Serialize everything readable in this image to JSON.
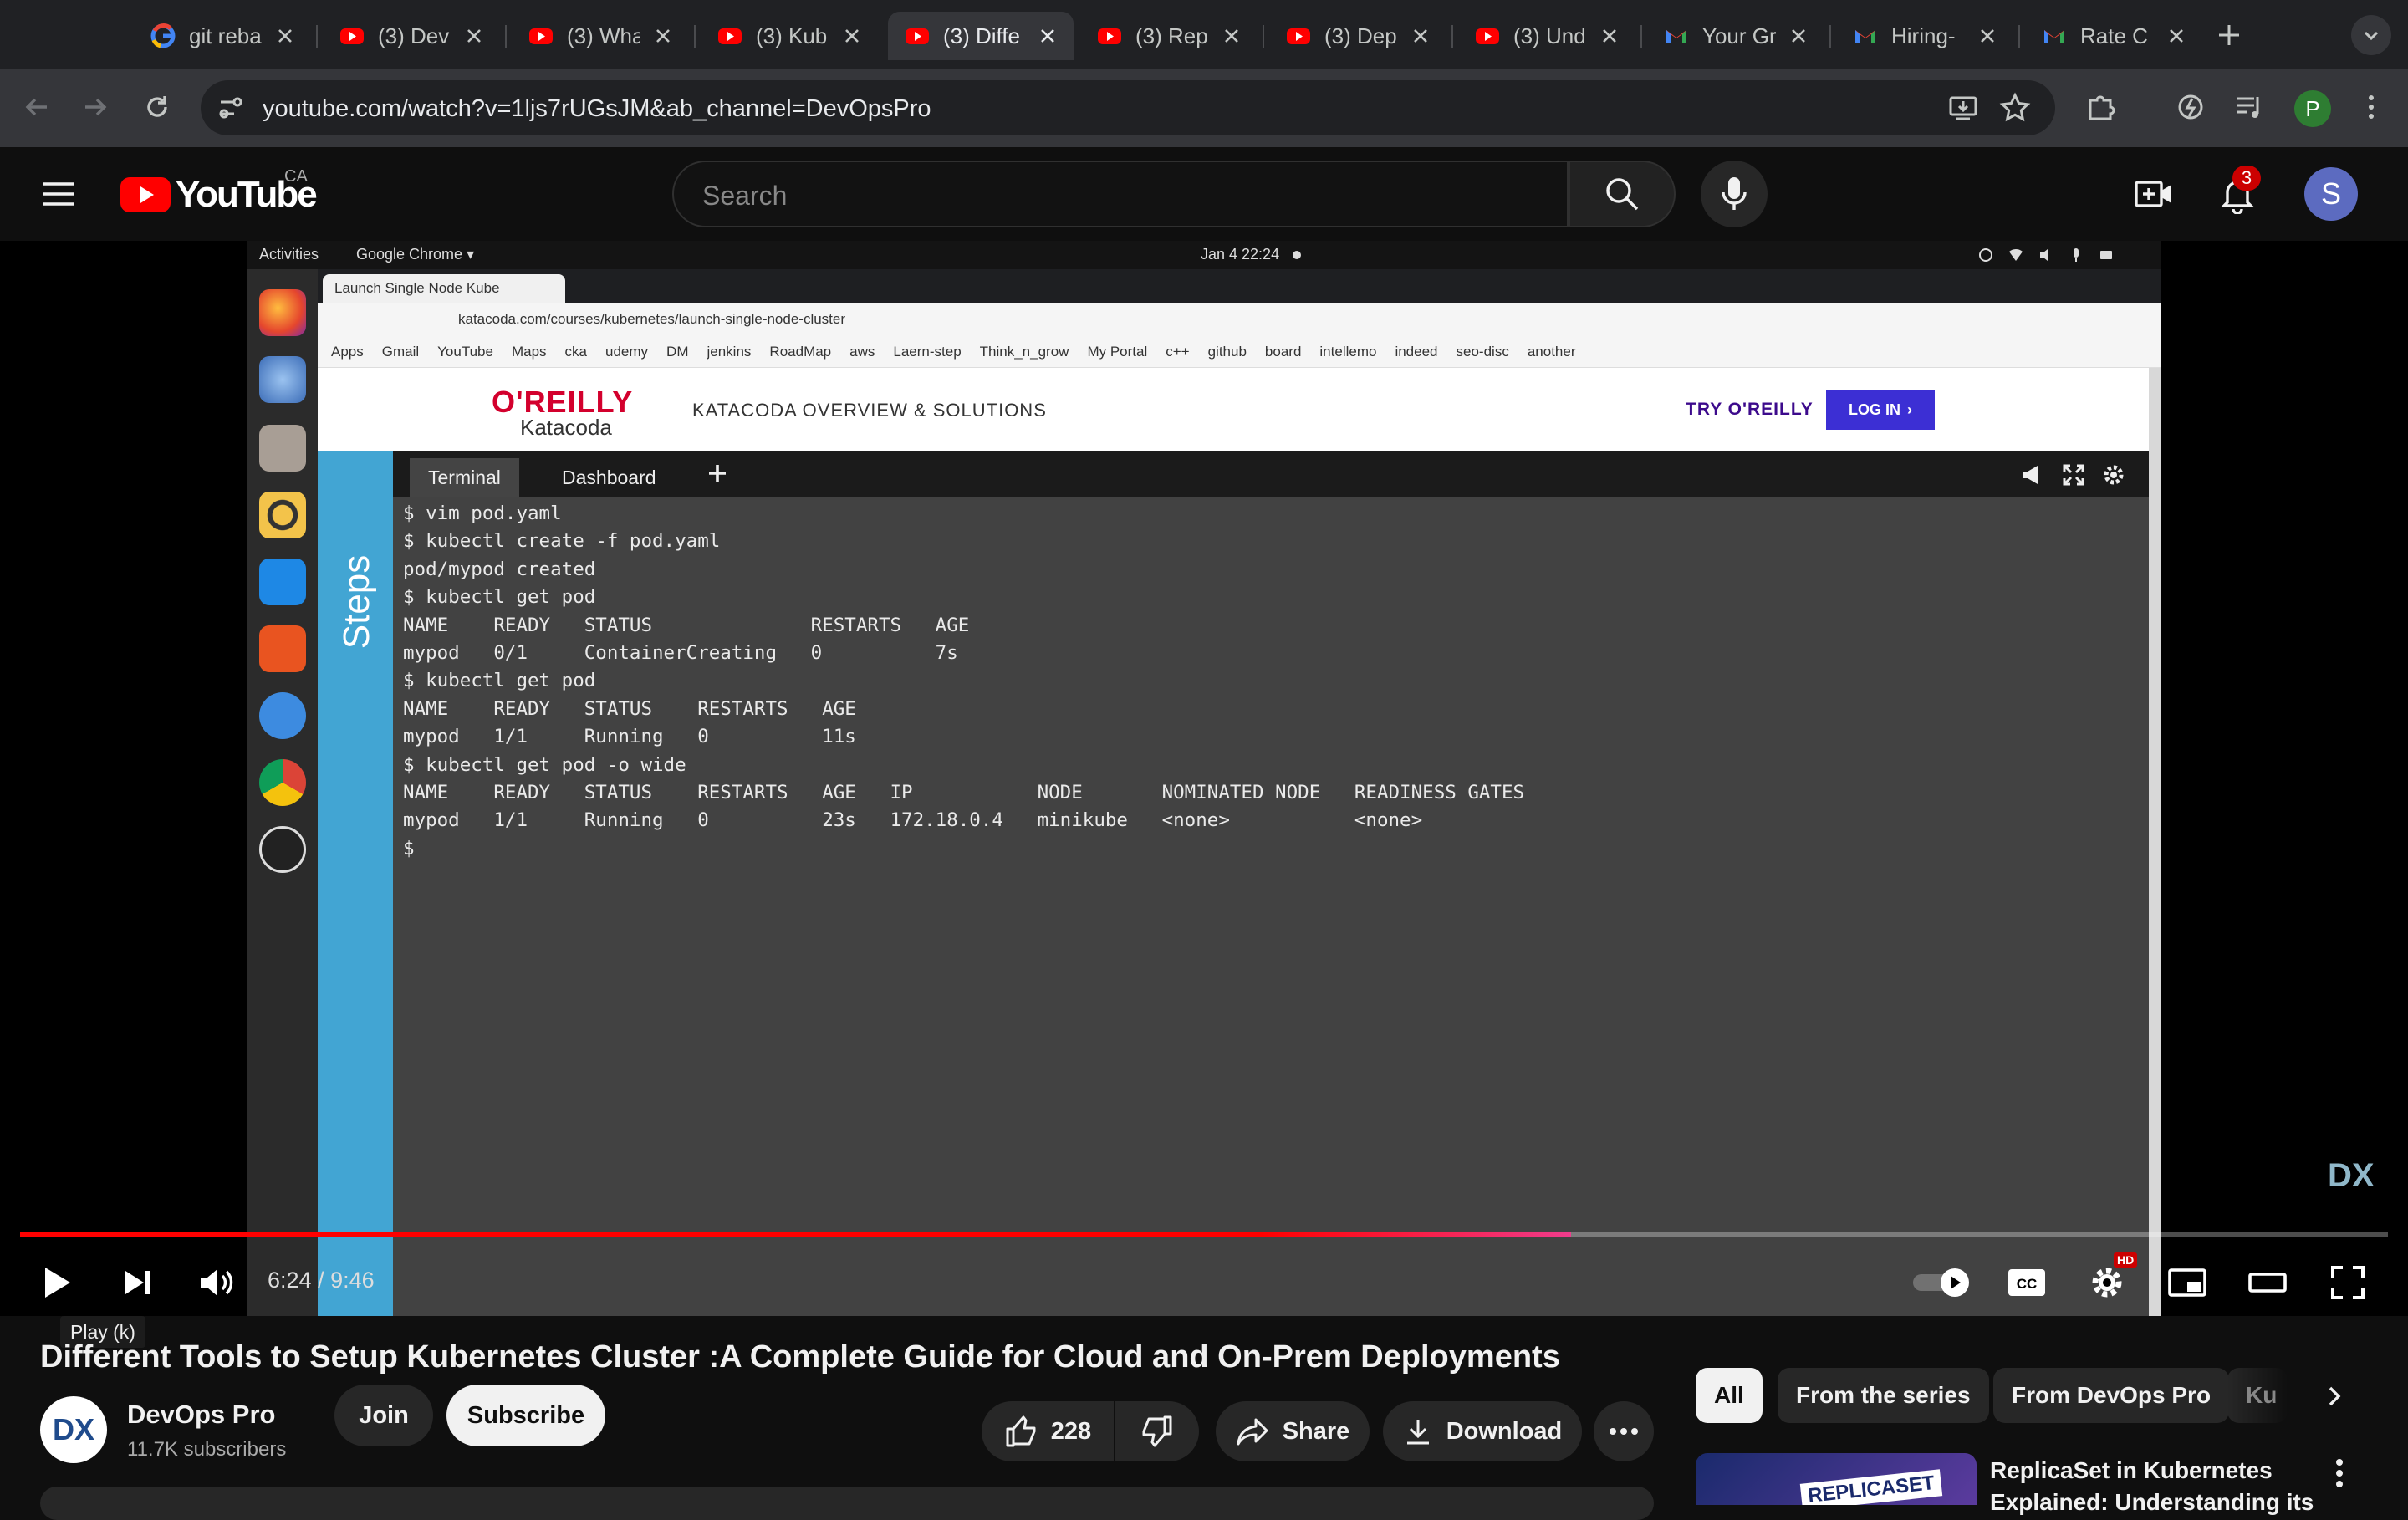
{
  "browser": {
    "tabs": [
      {
        "title": "git reba",
        "favicon": "google-icon"
      },
      {
        "title": "(3) Dev",
        "favicon": "youtube-icon"
      },
      {
        "title": "(3) Wha",
        "favicon": "youtube-icon"
      },
      {
        "title": "(3) Kub",
        "favicon": "youtube-icon"
      },
      {
        "title": "(3) Diffe",
        "favicon": "youtube-icon",
        "active": true
      },
      {
        "title": "(3) Rep",
        "favicon": "youtube-icon"
      },
      {
        "title": "(3) Dep",
        "favicon": "youtube-icon"
      },
      {
        "title": "(3) Und",
        "favicon": "youtube-icon"
      },
      {
        "title": "Your Gr",
        "favicon": "gmail-icon"
      },
      {
        "title": "Hiring-",
        "favicon": "gmail-icon"
      },
      {
        "title": "Rate C",
        "favicon": "gmail-icon"
      }
    ],
    "url": "youtube.com/watch?v=1ljs7rUGsJM&ab_channel=DevOpsPro",
    "profile_initial": "P"
  },
  "youtube": {
    "logo_text": "YouTube",
    "region": "CA",
    "search_placeholder": "Search",
    "notification_count": "3",
    "avatar_initial": "S"
  },
  "video_content": {
    "ubuntu_bar": {
      "activities": "Activities",
      "app": "Google Chrome ▾",
      "clock": "Jan 4  22:24"
    },
    "inner_tab_title": "Launch Single Node Kube",
    "inner_url": "katacoda.com/courses/kubernetes/launch-single-node-cluster",
    "bookmarks": [
      "Apps",
      "Gmail",
      "YouTube",
      "Maps",
      "cka",
      "udemy",
      "DM",
      "jenkins",
      "RoadMap",
      "aws",
      "Laern-step",
      "Think_n_grow",
      "My Portal",
      "c++",
      "github",
      "board",
      "intellemo",
      "indeed",
      "seo-disc",
      "another"
    ],
    "katacoda": {
      "brand": "O'REILLY",
      "sub_brand": "Katacoda",
      "overview": "KATACODA OVERVIEW & SOLUTIONS",
      "try": "TRY O'REILLY",
      "login": "LOG IN"
    },
    "steps_label": "Steps",
    "terminal_tabs": [
      "Terminal",
      "Dashboard"
    ],
    "terminal_lines": [
      "$ vim pod.yaml",
      "$ kubectl create -f pod.yaml",
      "pod/mypod created",
      "$ kubectl get pod",
      "NAME    READY   STATUS              RESTARTS   AGE",
      "mypod   0/1     ContainerCreating   0          7s",
      "$ kubectl get pod",
      "NAME    READY   STATUS    RESTARTS   AGE",
      "mypod   1/1     Running   0          11s",
      "$ kubectl get pod -o wide",
      "NAME    READY   STATUS    RESTARTS   AGE   IP           NODE       NOMINATED NODE   READINESS GATES",
      "mypod   1/1     Running   0          23s   172.18.0.4   minikube   <none>           <none>",
      "$"
    ],
    "watermark": "DX"
  },
  "player": {
    "time_current": "6:24",
    "time_separator": " / ",
    "time_total": "9:46",
    "progress_played_fraction": 0.655,
    "hd_badge": "HD",
    "tooltip": "Play (k)"
  },
  "video": {
    "title": "Different Tools to Setup Kubernetes Cluster :A Complete Guide for Cloud and On-Prem Deployments",
    "channel_name": "DevOps Pro",
    "subscribers": "11.7K subscribers",
    "join_label": "Join",
    "subscribe_label": "Subscribe",
    "likes": "228",
    "share_label": "Share",
    "download_label": "Download",
    "channel_avatar_text": "DX"
  },
  "chips": [
    "All",
    "From the series",
    "From DevOps Pro",
    "Ku"
  ],
  "recommendation": {
    "title": "ReplicaSet in Kubernetes Explained: Understanding its",
    "thumb_text": "REPLICASET"
  }
}
